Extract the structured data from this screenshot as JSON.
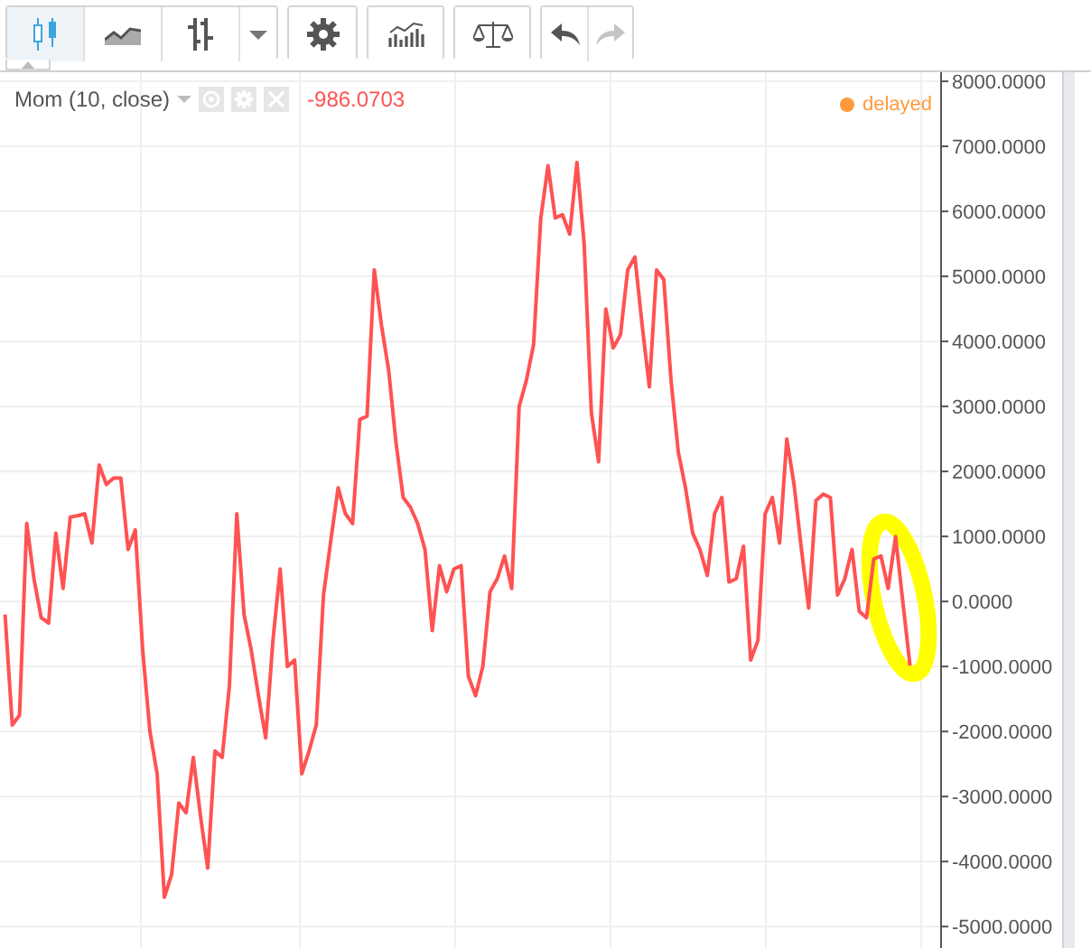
{
  "toolbar": {
    "groups": [
      [
        {
          "kind": "candles",
          "selected": true,
          "disabled": false
        },
        {
          "kind": "area",
          "selected": false,
          "disabled": false
        },
        {
          "kind": "bars",
          "selected": false,
          "disabled": false
        },
        {
          "kind": "dropdown",
          "selected": false,
          "disabled": false
        }
      ],
      [
        {
          "kind": "settings",
          "selected": false,
          "disabled": false
        }
      ],
      [
        {
          "kind": "indicators",
          "selected": false,
          "disabled": false
        }
      ],
      [
        {
          "kind": "scales",
          "selected": false,
          "disabled": false
        }
      ],
      [
        {
          "kind": "undo",
          "selected": false,
          "disabled": false
        },
        {
          "kind": "redo",
          "selected": false,
          "disabled": true
        }
      ]
    ]
  },
  "legend": {
    "value": "-986.0703"
  },
  "highlight": {
    "color": "#ffff00"
  },
  "status": {
    "label": "delayed",
    "color": "#ff9a3c"
  },
  "chart_data": {
    "type": "line",
    "grid": true,
    "ylim": [
      -5330,
      8140
    ],
    "yticks": [
      {
        "value": 8000,
        "label": "8000.0000"
      },
      {
        "value": 7000,
        "label": "7000.0000"
      },
      {
        "value": 6000,
        "label": "6000.0000"
      },
      {
        "value": 5000,
        "label": "5000.0000"
      },
      {
        "value": 4000,
        "label": "4000.0000"
      },
      {
        "value": 3000,
        "label": "3000.0000"
      },
      {
        "value": 2000,
        "label": "2000.0000"
      },
      {
        "value": 1000,
        "label": "1000.0000"
      },
      {
        "value": 0,
        "label": "0.0000"
      },
      {
        "value": -1000,
        "label": "-1000.0000"
      },
      {
        "value": -2000,
        "label": "-2000.0000"
      },
      {
        "value": -3000,
        "label": "-3000.0000"
      },
      {
        "value": -4000,
        "label": "-4000.0000"
      },
      {
        "value": -5000,
        "label": "-5000.0000"
      }
    ],
    "series": [
      {
        "name": "Mom (10, close)",
        "color": "#ff5252",
        "values": [
          -200,
          -1900,
          -1750,
          1200,
          350,
          -250,
          -330,
          1050,
          200,
          1300,
          1320,
          1350,
          900,
          2100,
          1800,
          1900,
          1900,
          800,
          1100,
          -750,
          -2000,
          -2650,
          -4550,
          -4200,
          -3100,
          -3250,
          -2400,
          -3300,
          -4100,
          -2300,
          -2400,
          -1300,
          1350,
          -200,
          -750,
          -1450,
          -2100,
          -600,
          500,
          -1000,
          -900,
          -2650,
          -2300,
          -1900,
          100,
          950,
          1750,
          1350,
          1200,
          2800,
          2850,
          5100,
          4250,
          3550,
          2450,
          1600,
          1450,
          1200,
          800,
          -450,
          550,
          150,
          500,
          550,
          -1150,
          -1450,
          -1000,
          150,
          350,
          700,
          200,
          3000,
          3400,
          3950,
          5900,
          6700,
          5900,
          5950,
          5650,
          6750,
          5500,
          2900,
          2150,
          4500,
          3900,
          4100,
          5100,
          5300,
          4250,
          3300,
          5100,
          4950,
          3400,
          2300,
          1750,
          1050,
          800,
          400,
          1350,
          1600,
          300,
          350,
          850,
          -900,
          -600,
          1350,
          1600,
          900,
          2500,
          1800,
          800,
          -100,
          1550,
          1650,
          1600,
          100,
          350,
          800,
          -150,
          -250,
          650,
          700,
          200,
          1000,
          0,
          -986
        ]
      }
    ]
  }
}
